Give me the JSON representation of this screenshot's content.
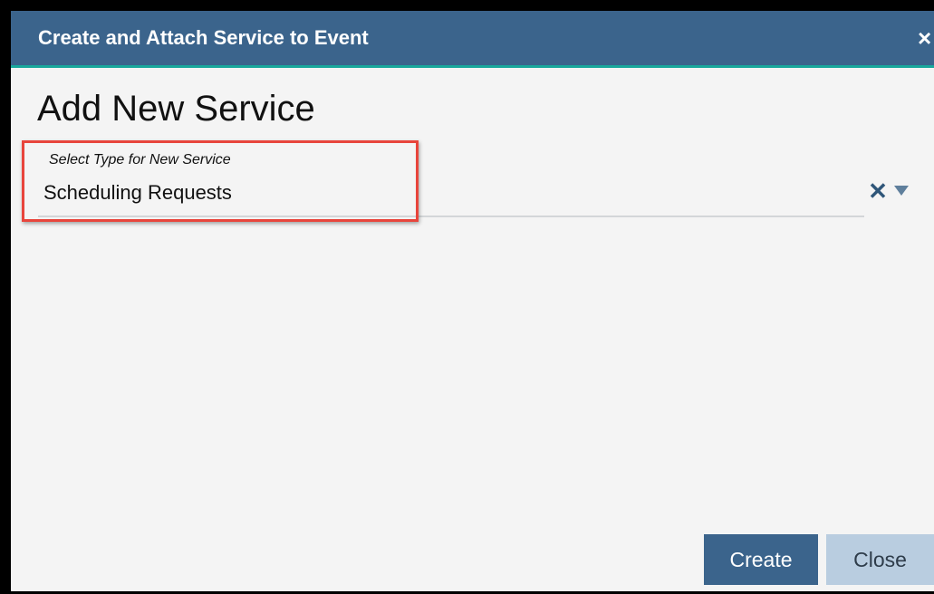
{
  "dialog": {
    "title": "Create and Attach Service to Event",
    "close_glyph": "×",
    "heading": "Add New Service"
  },
  "service_type_field": {
    "label": "Select Type for New Service",
    "value": "Scheduling Requests",
    "clear_glyph": "✕",
    "dropdown_icon": "triangle-down-icon"
  },
  "actions": {
    "create_label": "Create",
    "close_label": "Close"
  },
  "colors": {
    "titlebar": "#3b648c",
    "titlebar_accent": "#19a89c",
    "highlight": "#e8453c",
    "primary_button": "#3b648c",
    "secondary_button": "#b9cde0"
  }
}
